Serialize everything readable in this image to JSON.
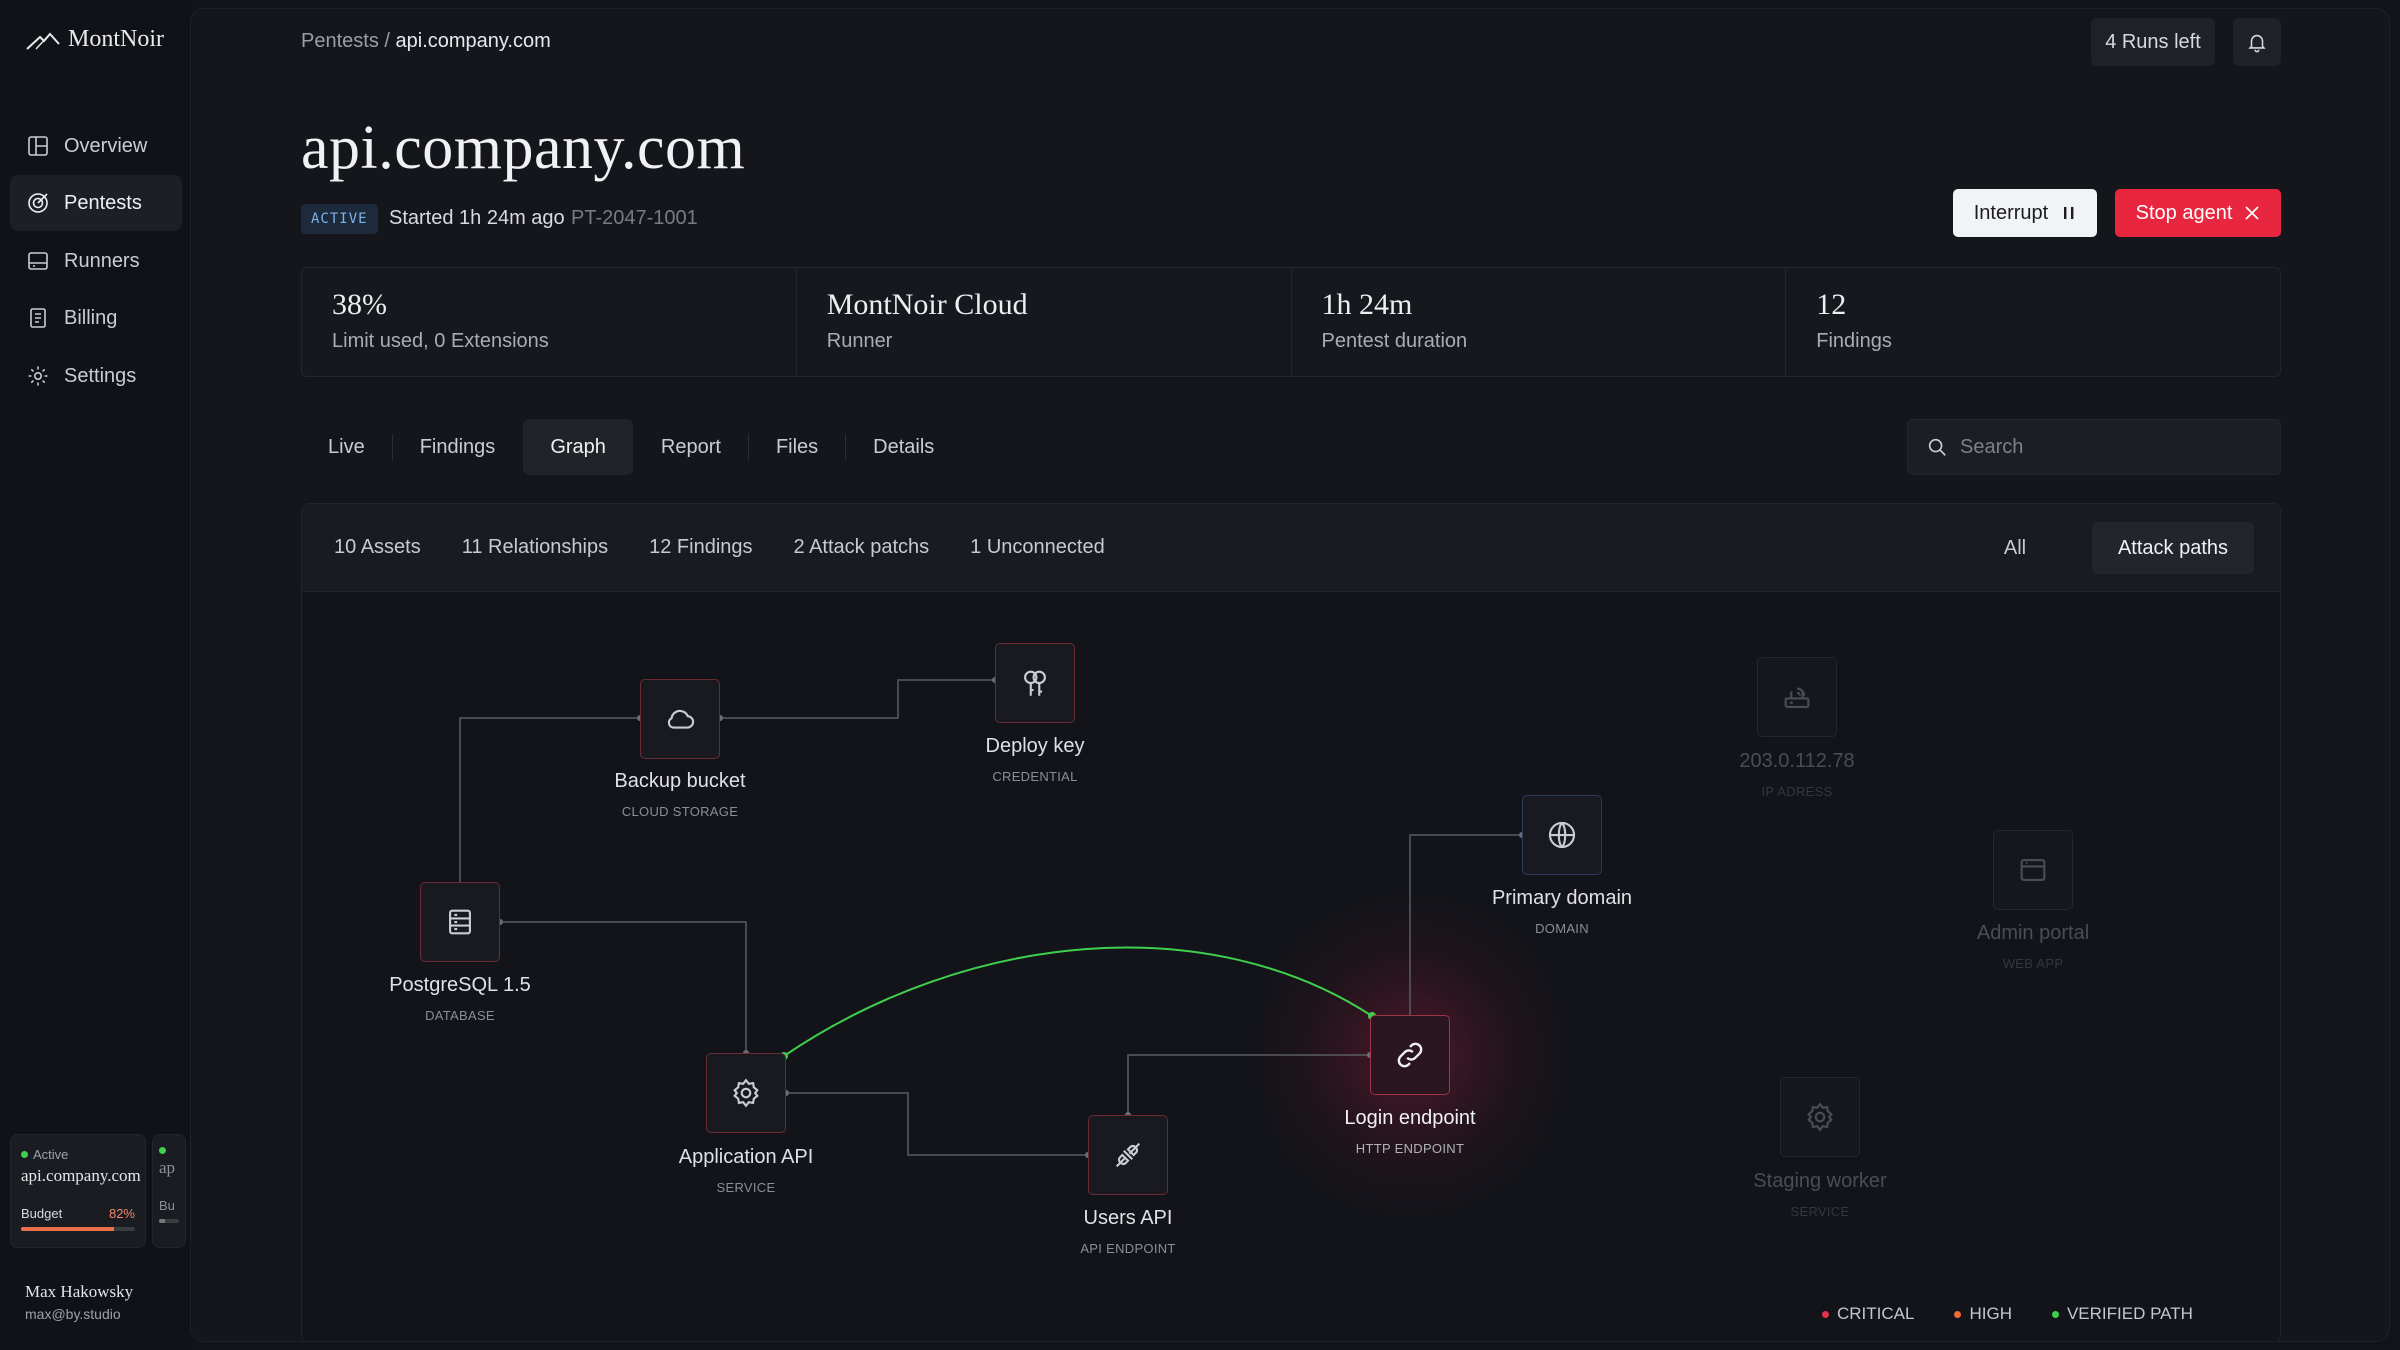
{
  "app": {
    "name": "MontNoir"
  },
  "sidebar": {
    "items": [
      {
        "label": "Overview",
        "icon": "grid-icon"
      },
      {
        "label": "Pentests",
        "icon": "target-icon"
      },
      {
        "label": "Runners",
        "icon": "server-icon"
      },
      {
        "label": "Billing",
        "icon": "receipt-icon"
      },
      {
        "label": "Settings",
        "icon": "gear-icon"
      }
    ],
    "active": "Pentests",
    "run_card": {
      "status": "Active",
      "target": "api.company.com",
      "budget_label": "Budget",
      "budget_value": "82%",
      "budget_fraction": 0.82
    },
    "run_card_2": {
      "status": "●",
      "target": "ap",
      "budget_label": "Bu"
    },
    "user": {
      "name": "Max Hakowsky",
      "email": "max@by.studio"
    }
  },
  "header": {
    "breadcrumb_parent": "Pentests",
    "breadcrumb_sep": " / ",
    "breadcrumb_current": "api.company.com",
    "runs_left": "4 Runs left"
  },
  "pentest": {
    "title": "api.company.com",
    "status": "ACTIVE",
    "started": "Started 1h 24m ago",
    "id": "PT-2047-1001",
    "interrupt_label": "Interrupt",
    "stop_label": "Stop agent"
  },
  "stats": [
    {
      "value": "38%",
      "label": "Limit used, 0 Extensions"
    },
    {
      "value": "MontNoir Cloud",
      "label": "Runner"
    },
    {
      "value": "1h 24m",
      "label": "Pentest duration"
    },
    {
      "value": "12",
      "label": "Findings"
    }
  ],
  "tabs": [
    "Live",
    "Findings",
    "Graph",
    "Report",
    "Files",
    "Details"
  ],
  "active_tab": "Graph",
  "search": {
    "placeholder": "Search"
  },
  "graph": {
    "summary": [
      "10 Assets",
      "11 Relationships",
      "12 Findings",
      "2 Attack patchs",
      "1 Unconnected"
    ],
    "filter_all": "All",
    "filter_attack": "Attack paths",
    "nodes": {
      "backup": {
        "label": "Backup bucket",
        "type": "CLOUD STORAGE"
      },
      "deploy": {
        "label": "Deploy key",
        "type": "CREDENTIAL"
      },
      "postgres": {
        "label": "PostgreSQL 1.5",
        "type": "DATABASE"
      },
      "appapi": {
        "label": "Application API",
        "type": "SERVICE"
      },
      "usersapi": {
        "label": "Users API",
        "type": "API ENDPOINT"
      },
      "login": {
        "label": "Login endpoint",
        "type": "HTTP ENDPOINT"
      },
      "domain": {
        "label": "Primary domain",
        "type": "DOMAIN"
      },
      "ip": {
        "label": "203.0.112.78",
        "type": "IP ADRESS"
      },
      "admin": {
        "label": "Admin portal",
        "type": "WEB APP"
      },
      "staging": {
        "label": "Staging worker",
        "type": "SERVICE"
      }
    },
    "legend": [
      {
        "label": "CRITICAL",
        "color": "#e5324f"
      },
      {
        "label": "HIGH",
        "color": "#ef6a3a"
      },
      {
        "label": "VERIFIED PATH",
        "color": "#3ecf4c"
      }
    ]
  },
  "colors": {
    "accent_red": "#e8263f",
    "verified": "#3ecf4c",
    "badge_blue": "#7fb1ea"
  }
}
